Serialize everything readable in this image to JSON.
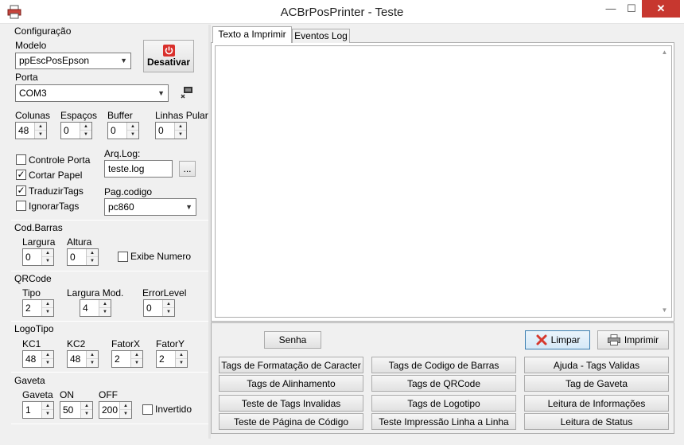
{
  "window": {
    "title": "ACBrPosPrinter - Teste",
    "minimize_glyph": "—",
    "maximize_glyph": "☐",
    "close_glyph": "✕",
    "close_color": "#c7372f"
  },
  "config": {
    "group_label": "Configuração",
    "modelo_label": "Modelo",
    "modelo_value": "ppEscPosEpson",
    "desativar_label": "Desativar",
    "porta_label": "Porta",
    "porta_value": "COM3",
    "colunas_label": "Colunas",
    "colunas_value": "48",
    "espacos_label": "Espaços",
    "espacos_value": "0",
    "buffer_label": "Buffer",
    "buffer_value": "0",
    "linhas_label": "Linhas Pular",
    "linhas_value": "0",
    "controle_porta_label": "Controle Porta",
    "controle_porta_checked": false,
    "cortar_papel_label": "Cortar Papel",
    "cortar_papel_checked": true,
    "traduzir_tags_label": "TraduzirTags",
    "traduzir_tags_checked": true,
    "ignorar_tags_label": "IgnorarTags",
    "ignorar_tags_checked": false,
    "arq_log_label": "Arq.Log:",
    "arq_log_value": "teste.log",
    "browse_label": "...",
    "pag_codigo_label": "Pag.codigo",
    "pag_codigo_value": "pc860"
  },
  "codbarras": {
    "group_label": "Cod.Barras",
    "largura_label": "Largura",
    "largura_value": "0",
    "altura_label": "Altura",
    "altura_value": "0",
    "exibe_numero_label": "Exibe Numero",
    "exibe_numero_checked": false
  },
  "qrcode": {
    "group_label": "QRCode",
    "tipo_label": "Tipo",
    "tipo_value": "2",
    "largura_mod_label": "Largura Mod.",
    "largura_mod_value": "4",
    "error_level_label": "ErrorLevel",
    "error_level_value": "0"
  },
  "logotipo": {
    "group_label": "LogoTipo",
    "kc1_label": "KC1",
    "kc1_value": "48",
    "kc2_label": "KC2",
    "kc2_value": "48",
    "fatorx_label": "FatorX",
    "fatorx_value": "2",
    "fatory_label": "FatorY",
    "fatory_value": "2"
  },
  "gaveta": {
    "group_label": "Gaveta",
    "gaveta_label": "Gaveta",
    "gaveta_value": "1",
    "on_label": "ON",
    "on_value": "50",
    "off_label": "OFF",
    "off_value": "200",
    "invertido_label": "Invertido",
    "invertido_checked": false
  },
  "tabs": {
    "texto_label": "Texto a Imprimir",
    "eventos_label": "Eventos Log"
  },
  "actions": {
    "senha_label": "Senha",
    "limpar_label": "Limpar",
    "imprimir_label": "Imprimir"
  },
  "tag_buttons": [
    "Tags de Formatação de Caracter",
    "Tags de Codigo de Barras",
    "Ajuda - Tags Validas",
    "Tags de Alinhamento",
    "Tags de QRCode",
    "Tag de Gaveta",
    "Teste de Tags Invalidas",
    "Tags de Logotipo",
    "Leitura de Informações",
    "Teste de Página de Código",
    "Teste Impressão Linha a Linha",
    "Leitura de Status"
  ],
  "icons": {
    "app": "printer-icon",
    "power": "power-icon",
    "port_config": "port-settings-icon",
    "limpar": "red-x-icon",
    "imprimir": "printer-icon"
  },
  "colors": {
    "power_red": "#d9302c",
    "limpar_x": "#d63a2f",
    "focus_border": "#3c7fb1"
  },
  "glyphs": {
    "spin_up": "▲",
    "spin_down": "▼",
    "combo_arrow": "▼",
    "check": "✓",
    "scroll_up": "▲",
    "scroll_down": "▼"
  }
}
